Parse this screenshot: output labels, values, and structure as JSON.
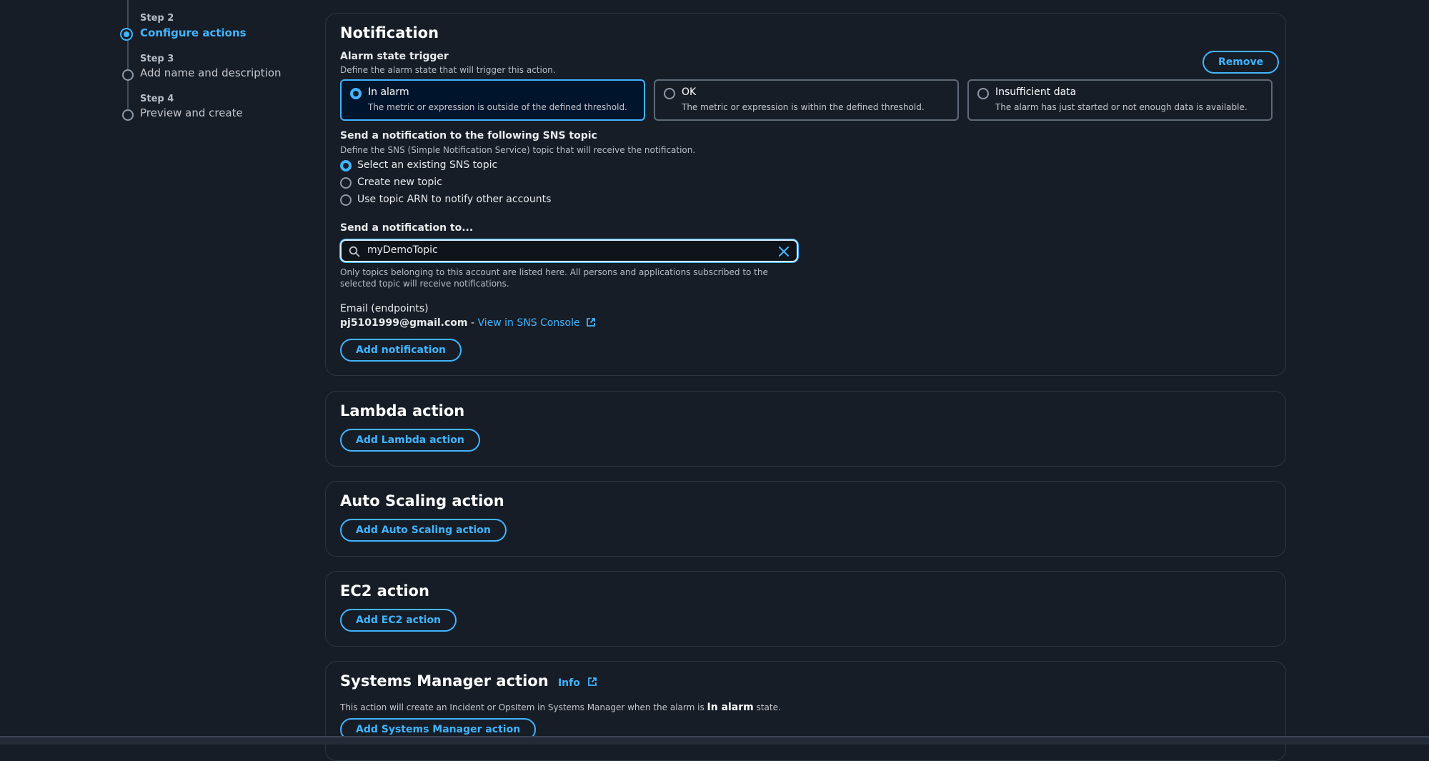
{
  "stepper": {
    "steps": [
      {
        "step": "Step 2",
        "label": "Configure actions",
        "state": "active"
      },
      {
        "step": "Step 3",
        "label": "Add name and description",
        "state": "pending"
      },
      {
        "step": "Step 4",
        "label": "Preview and create",
        "state": "pending"
      }
    ]
  },
  "notification": {
    "title": "Notification",
    "remove_label": "Remove",
    "alarm_state": {
      "label": "Alarm state trigger",
      "description": "Define the alarm state that will trigger this action.",
      "options": [
        {
          "title": "In alarm",
          "description": "The metric or expression is outside of the defined threshold.",
          "selected": true
        },
        {
          "title": "OK",
          "description": "The metric or expression is within the defined threshold.",
          "selected": false
        },
        {
          "title": "Insufficient data",
          "description": "The alarm has just started or not enough data is available.",
          "selected": false
        }
      ]
    },
    "sns": {
      "label": "Send a notification to the following SNS topic",
      "description": "Define the SNS (Simple Notification Service) topic that will receive the notification.",
      "options": [
        {
          "label": "Select an existing SNS topic",
          "selected": true
        },
        {
          "label": "Create new topic",
          "selected": false
        },
        {
          "label": "Use topic ARN to notify other accounts",
          "selected": false
        }
      ]
    },
    "send_to": {
      "label": "Send a notification to...",
      "value": "myDemoTopic",
      "hint": "Only topics belonging to this account are listed here. All persons and applications subscribed to the selected topic will receive notifications."
    },
    "endpoints": {
      "label": "Email (endpoints)",
      "email": "pj5101999@gmail.com",
      "separator": " - ",
      "link": "View in SNS Console"
    },
    "add_label": "Add notification"
  },
  "lambda": {
    "title": "Lambda action",
    "button": "Add Lambda action"
  },
  "autoscaling": {
    "title": "Auto Scaling action",
    "button": "Add Auto Scaling action"
  },
  "ec2": {
    "title": "EC2 action",
    "button": "Add EC2 action"
  },
  "ssm": {
    "title": "Systems Manager action",
    "info": "Info",
    "desc_prefix": "This action will create an Incident or OpsItem in Systems Manager when the alarm is ",
    "desc_bold": "In alarm",
    "desc_suffix": " state.",
    "button": "Add Systems Manager action"
  },
  "colors": {
    "accent": "#42b4ff",
    "background": "#161d26",
    "border": "#2c3540"
  }
}
